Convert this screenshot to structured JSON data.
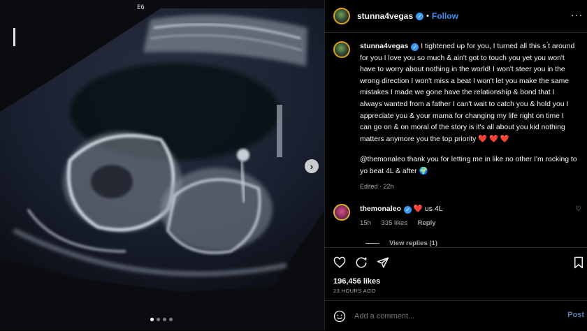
{
  "media": {
    "corner_label": "E6",
    "slide_count": 4,
    "active_slide": 1,
    "next_icon": "chevron-right-icon"
  },
  "header": {
    "username": "stunna4vegas",
    "separator": "•",
    "follow_label": "Follow",
    "more_label": "···"
  },
  "caption": {
    "username": "stunna4vegas",
    "text": "I tightened up for you, I turned all this s ́t around for you I love you so much & ain't got to touch you yet you won't have to worry about nothing in the world! I won't steer you in the wrong direction I won't miss a beat I won't let you make the same mistakes I made we gone have the relationship & bond that I always wanted from a father I can't wait to catch you & hold you I appreciate you & your mama for changing my life right on time I can go on & on moral of the story is it's all about you kid nothing matters anymore you the top priority",
    "hearts": "❤️ ❤️ ❤️",
    "second_para": "@themonaleo thank you for letting me in like no other I'm rocking to yo beat 4L & after 🌍",
    "meta": "Edited · 22h"
  },
  "comment": {
    "username": "themonaleo",
    "heart": "❤️",
    "text": "us 4L",
    "time": "15h",
    "likes": "335 likes",
    "reply_label": "Reply",
    "view_replies": "View replies (1)"
  },
  "actions": {
    "like_icon": "heart-icon",
    "comment_icon": "comment-icon",
    "share_icon": "share-icon",
    "save_icon": "bookmark-icon"
  },
  "stats": {
    "likes": "196,456 likes",
    "time_ago": "23 HOURS AGO"
  },
  "add_comment": {
    "placeholder": "Add a comment...",
    "post_label": "Post"
  },
  "colors": {
    "link_blue": "#3a8ef5",
    "verified_blue": "#3897f0",
    "heart_red": "#e0202a"
  }
}
